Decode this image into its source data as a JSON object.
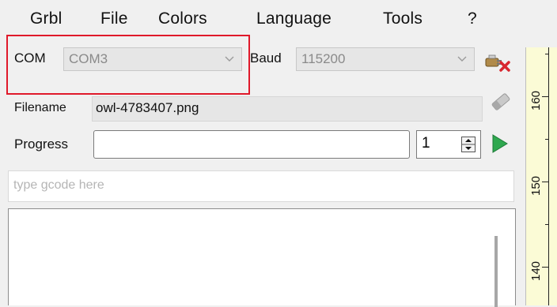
{
  "menu": {
    "items": [
      "Grbl",
      "File",
      "Colors",
      "Language",
      "Tools",
      "?"
    ]
  },
  "connection": {
    "com_label": "COM",
    "com_value": "COM3",
    "baud_label": "Baud",
    "baud_value": "115200"
  },
  "file": {
    "filename_label": "Filename",
    "filename_value": "owl-4783407.png"
  },
  "progress": {
    "label": "Progress",
    "value": "",
    "copies": "1"
  },
  "gcode": {
    "placeholder": "type gcode here"
  },
  "ruler": {
    "labels": [
      "160",
      "150",
      "140"
    ]
  },
  "colors": {
    "highlight": "#e0192a",
    "play": "#2fa84f",
    "ruler_bg": "#fbfbd6"
  },
  "icons": {
    "disconnect": "plug-x-icon",
    "clear": "eraser-icon",
    "run": "play-icon",
    "spinner": "up-down-arrows-icon"
  }
}
